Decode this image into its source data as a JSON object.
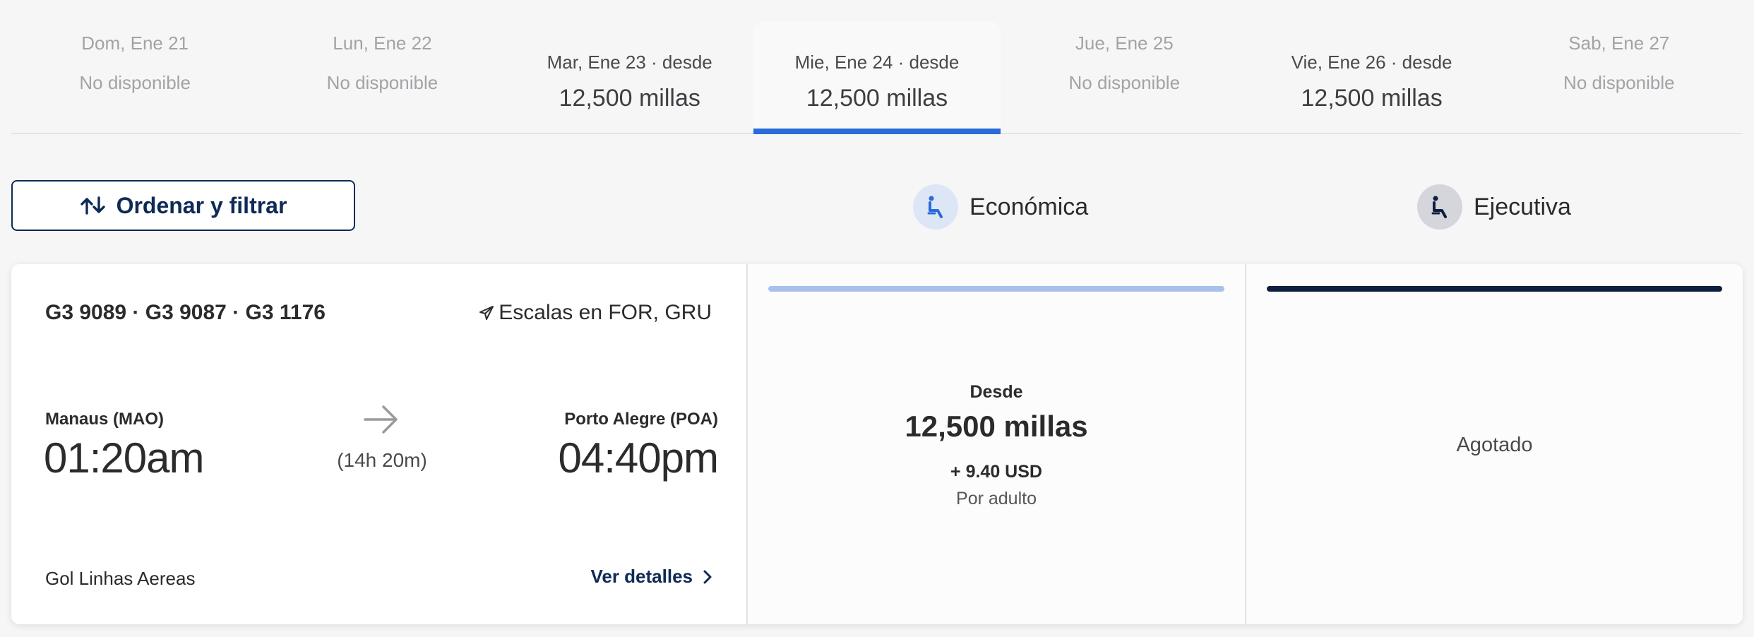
{
  "date_tabs": [
    {
      "label": "Dom, Ene 21",
      "value": "No disponible",
      "available": false
    },
    {
      "label": "Lun, Ene 22",
      "value": "No disponible",
      "available": false
    },
    {
      "label": "Mar, Ene 23 · desde",
      "value": "12,500 millas",
      "available": true
    },
    {
      "label": "Mie, Ene 24 · desde",
      "value": "12,500 millas",
      "available": true
    },
    {
      "label": "Jue, Ene 25",
      "value": "No disponible",
      "available": false
    },
    {
      "label": "Vie, Ene 26 · desde",
      "value": "12,500 millas",
      "available": true
    },
    {
      "label": "Sab, Ene 27",
      "value": "No disponible",
      "available": false
    }
  ],
  "sort_filter": {
    "label": "Ordenar y filtrar",
    "icon": "sort-arrows-icon"
  },
  "cabins": {
    "economy": {
      "label": "Económica",
      "icon": "seat-icon"
    },
    "business": {
      "label": "Ejecutiva",
      "icon": "seat-icon"
    }
  },
  "flight": {
    "numbers": "G3 9089 · G3 9087 · G3 1176",
    "stops": "Escalas en FOR, GRU",
    "origin": {
      "city": "Manaus (MAO)",
      "time": "01:20am"
    },
    "destination": {
      "city": "Porto Alegre (POA)",
      "time": "04:40pm"
    },
    "duration": "(14h 20m)",
    "airline": "Gol Linhas Aereas",
    "details_link": "Ver detalles"
  },
  "fares": {
    "economy": {
      "from_label": "Desde",
      "price": "12,500 millas",
      "taxes": "+ 9.40 USD",
      "per": "Por adulto"
    },
    "business": {
      "status": "Agotado"
    }
  },
  "colors": {
    "selected_underline": "#2a6ad9",
    "navy": "#0e2a55",
    "economy_bar": "#a7c0ec",
    "business_bar": "#0e1f3d"
  }
}
